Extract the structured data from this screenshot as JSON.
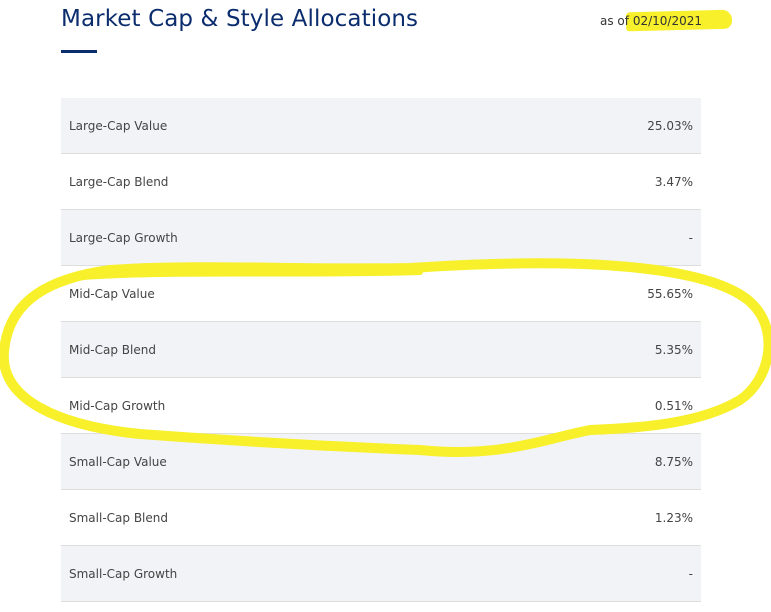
{
  "header": {
    "title": "Market Cap & Style Allocations",
    "as_of_label": "as of",
    "as_of_date": "02/10/2021"
  },
  "allocations": [
    {
      "label": "Large-Cap Value",
      "value": "25.03%"
    },
    {
      "label": "Large-Cap Blend",
      "value": "3.47%"
    },
    {
      "label": "Large-Cap Growth",
      "value": "-"
    },
    {
      "label": "Mid-Cap Value",
      "value": "55.65%"
    },
    {
      "label": "Mid-Cap Blend",
      "value": "5.35%"
    },
    {
      "label": "Mid-Cap Growth",
      "value": "0.51%"
    },
    {
      "label": "Small-Cap Value",
      "value": "8.75%"
    },
    {
      "label": "Small-Cap Blend",
      "value": "1.23%"
    },
    {
      "label": "Small-Cap Growth",
      "value": "-"
    }
  ],
  "colors": {
    "title": "#0b2d6e",
    "highlighter": "#f7f02a",
    "row_shade": "#f2f3f7",
    "row_border": "#dedede"
  }
}
